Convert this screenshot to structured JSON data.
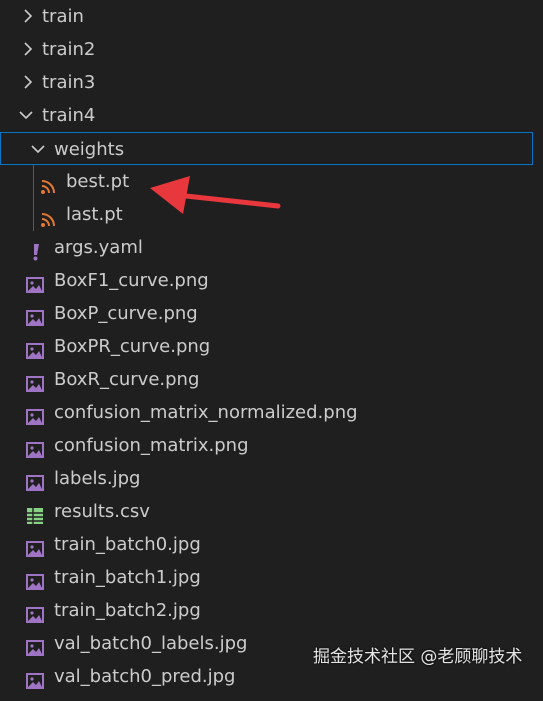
{
  "explorer": {
    "folders": {
      "train": "train",
      "train2": "train2",
      "train3": "train3",
      "train4": "train4",
      "weights": "weights"
    },
    "weights_files": [
      "best.pt",
      "last.pt"
    ],
    "yaml_file": "args.yaml",
    "images": [
      "BoxF1_curve.png",
      "BoxP_curve.png",
      "BoxPR_curve.png",
      "BoxR_curve.png",
      "confusion_matrix_normalized.png",
      "confusion_matrix.png",
      "labels.jpg"
    ],
    "csv_file": "results.csv",
    "batch_images": [
      "train_batch0.jpg",
      "train_batch1.jpg",
      "train_batch2.jpg",
      "val_batch0_labels.jpg",
      "val_batch0_pred.jpg"
    ]
  },
  "watermark": "掘金技术社区 @老顾聊技术",
  "colors": {
    "background": "#1f1f1f",
    "text": "#cccccc",
    "selection_border": "#0a74c6",
    "pt_icon": "#e37933",
    "yaml_icon": "#a074c4",
    "image_icon": "#a074c4",
    "csv_icon": "#89d185",
    "arrow": "#e8383d"
  },
  "icons": {
    "collapsed": "chevron-right-icon",
    "expanded": "chevron-down-icon",
    "pt": "rss-icon",
    "yaml": "exclamation-icon",
    "image": "image-file-icon",
    "csv": "table-icon"
  }
}
